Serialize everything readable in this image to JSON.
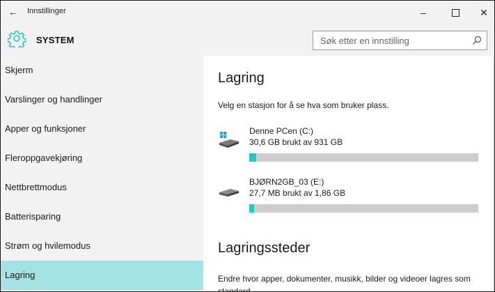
{
  "window": {
    "title": "Innstillinger",
    "back_symbol": "←",
    "minimize_symbol": "–",
    "close_symbol": "✕"
  },
  "header": {
    "title": "SYSTEM",
    "search_placeholder": "Søk etter en innstilling",
    "accent": "#26c6c6"
  },
  "sidebar": {
    "items": [
      {
        "label": "Skjerm"
      },
      {
        "label": "Varslinger og handlinger"
      },
      {
        "label": "Apper og funksjoner"
      },
      {
        "label": "Fleroppgavekjøring"
      },
      {
        "label": "Nettbrettmodus"
      },
      {
        "label": "Batterisparing"
      },
      {
        "label": "Strøm og hvilemodus"
      },
      {
        "label": "Lagring"
      }
    ],
    "active_index": 7,
    "active_color": "#a3e3e3"
  },
  "main": {
    "title": "Lagring",
    "subtitle": "Velg en stasjon for å se hva som bruker plass.",
    "drives": [
      {
        "name": "Denne PCen (C:)",
        "usage": "30,6 GB brukt av 931 GB",
        "fill_fraction": 0.03,
        "icon": "windows-drive-icon"
      },
      {
        "name": "BJØRN2GB_03 (E:)",
        "usage": "27,7 MB brukt av 1,86 GB",
        "fill_fraction": 0.015,
        "icon": "removable-drive-icon"
      }
    ],
    "locations_title": "Lagringssteder",
    "locations_text": "Endre hvor apper, dokumenter, musikk, bilder og videoer lagres som standard."
  }
}
